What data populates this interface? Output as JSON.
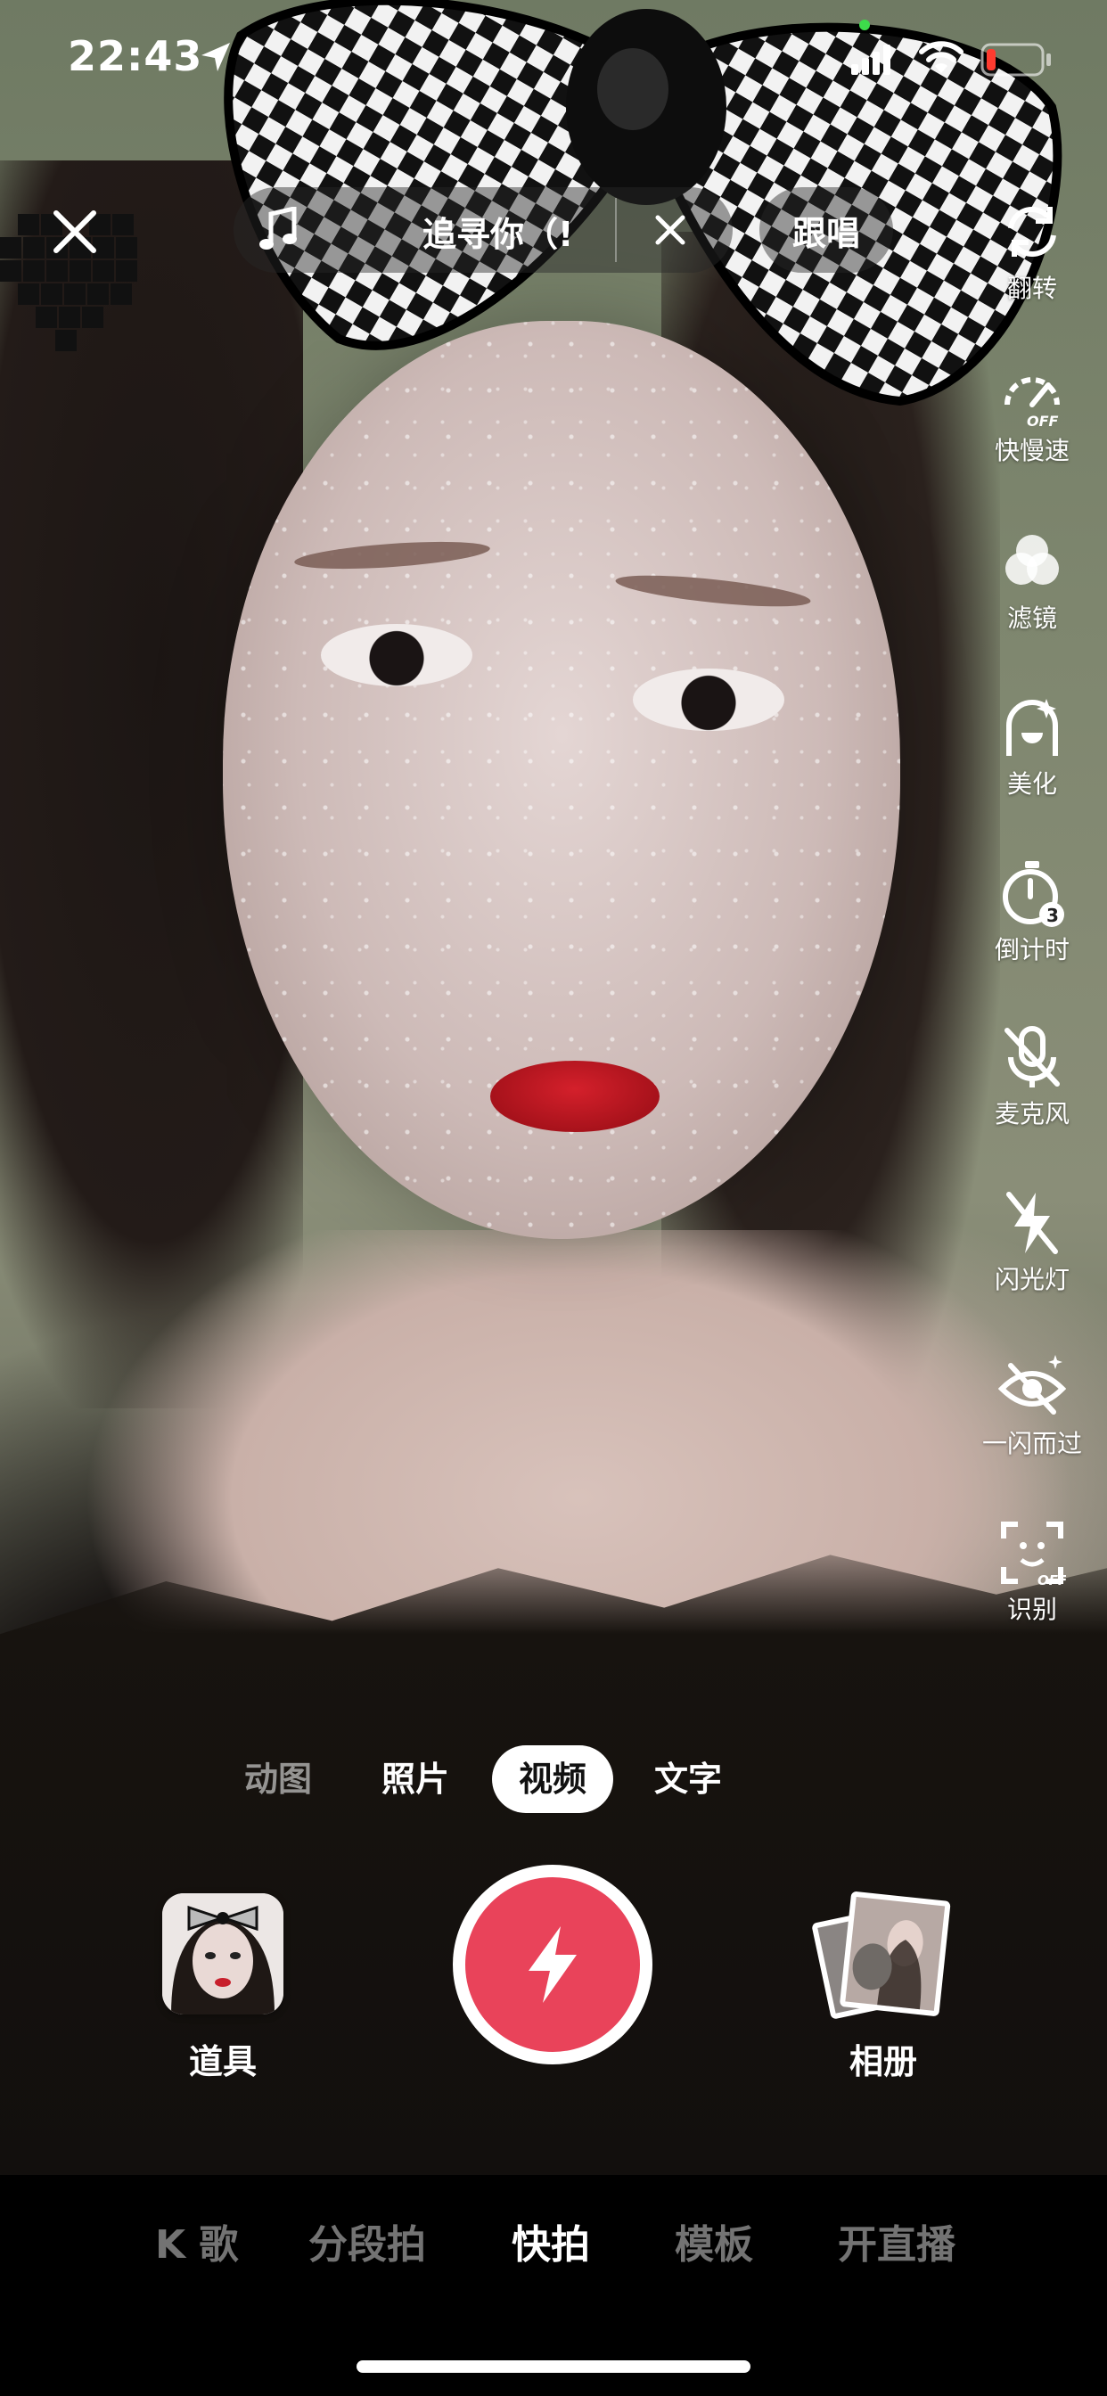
{
  "status_bar": {
    "time": "22:43"
  },
  "top_bar": {
    "music_title": "追寻你（!",
    "duet_label": "跟唱"
  },
  "right_tools": [
    {
      "label": "翻转",
      "icon": "flip-camera-icon"
    },
    {
      "label": "快慢速",
      "icon": "speed-off-icon"
    },
    {
      "label": "滤镜",
      "icon": "filter-icon"
    },
    {
      "label": "美化",
      "icon": "beautify-icon"
    },
    {
      "label": "倒计时",
      "icon": "countdown-icon"
    },
    {
      "label": "麦克风",
      "icon": "mic-off-icon"
    },
    {
      "label": "闪光灯",
      "icon": "flash-off-icon"
    },
    {
      "label": "一闪而过",
      "icon": "flash-by-icon"
    },
    {
      "label": "识别",
      "icon": "recognize-off-icon"
    }
  ],
  "capture_modes": {
    "items": [
      "动图",
      "照片",
      "视频",
      "文字"
    ],
    "selected": "视频"
  },
  "capture_row": {
    "props_label": "道具",
    "album_label": "相册"
  },
  "bottom_tabs": {
    "items": [
      "K 歌",
      "分段拍",
      "快拍",
      "模板",
      "开直播"
    ],
    "selected": "快拍"
  },
  "colors": {
    "shutter": "#e9435a",
    "active_mode_bg": "#ffffff"
  }
}
